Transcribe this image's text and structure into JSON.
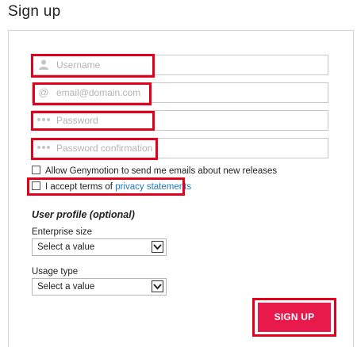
{
  "header": {
    "title": "Sign up"
  },
  "form": {
    "username_placeholder": "Username",
    "email_placeholder": "email@domain.com",
    "email_icon": "@",
    "password_placeholder": "Password",
    "password_confirm_placeholder": "Password confirmation",
    "allow_emails_label": "Allow Genymotion to send me emails about new releases",
    "accept_terms_label": "I accept terms of ",
    "privacy_link": "privacy statements"
  },
  "profile": {
    "title": "User profile (optional)",
    "enterprise_size_label": "Enterprise size",
    "enterprise_size_value": "Select a value",
    "usage_type_label": "Usage type",
    "usage_type_value": "Select a value"
  },
  "actions": {
    "signup_label": "SIGN UP"
  },
  "colors": {
    "accent": "#e8194b",
    "highlight": "#e2001a",
    "link": "#1f78c1"
  }
}
